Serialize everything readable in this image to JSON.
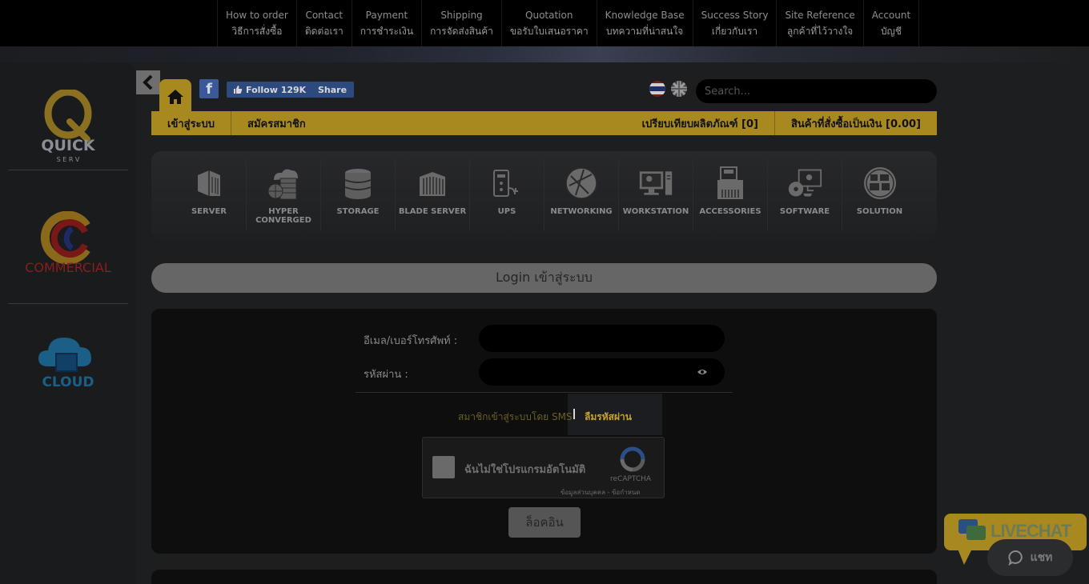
{
  "topnav": [
    {
      "en": "How to order",
      "th": "วิธีการสั่งซื้อ"
    },
    {
      "en": "Contact",
      "th": "ติดต่อเรา"
    },
    {
      "en": "Payment",
      "th": "การชำระเงิน"
    },
    {
      "en": "Shipping",
      "th": "การจัดส่งสินค้า"
    },
    {
      "en": "Quotation",
      "th": "ขอรับใบเสนอราคา"
    },
    {
      "en": "Knowledge Base",
      "th": "บทความที่น่าสนใจ"
    },
    {
      "en": "Success Story",
      "th": "เกี่ยวกับเรา"
    },
    {
      "en": "Site Reference",
      "th": "ลูกค้าที่ไว้วางใจ"
    },
    {
      "en": "Account",
      "th": "บัญชี"
    }
  ],
  "brands": {
    "quick": {
      "main": "QUICK",
      "sub": "S E R V"
    },
    "commercial": "COMMERCIAL",
    "cloud": "CLOUD"
  },
  "social": {
    "facebook_glyph": "f",
    "follow_label": "Follow 129K",
    "share_label": "Share"
  },
  "search": {
    "placeholder": "Search..."
  },
  "ybar": {
    "login": "เข้าสู่ระบบ",
    "register": "สมัครสมาชิก",
    "compare": "เปรียบเทียบผลิตภัณฑ์ [0]",
    "cart": "สินค้าที่สั่งซื้อเป็นเงิน [0.00]"
  },
  "categories": [
    {
      "label": "SERVER",
      "icon": "server-icon"
    },
    {
      "label": "HYPER CONVERGED",
      "icon": "hyper-converged-icon"
    },
    {
      "label": "STORAGE",
      "icon": "storage-icon"
    },
    {
      "label": "BLADE SERVER",
      "icon": "blade-server-icon"
    },
    {
      "label": "UPS",
      "icon": "ups-icon"
    },
    {
      "label": "NETWORKING",
      "icon": "networking-icon"
    },
    {
      "label": "WORKSTATION",
      "icon": "workstation-icon"
    },
    {
      "label": "ACCESSORIES",
      "icon": "accessories-icon"
    },
    {
      "label": "SOFTWARE",
      "icon": "software-icon"
    },
    {
      "label": "SOLUTION",
      "icon": "solution-icon"
    }
  ],
  "login": {
    "title": "Login เข้าสู่ระบบ",
    "email_label": "อีเมล/เบอร์โทรศัพท์ :",
    "email_value": "",
    "password_label": "รหัสผ่าน :",
    "password_value": "",
    "sms_link": "สมาชิกเข้าสู่ระบบโดย SMS",
    "forgot_link": "ลืมรหัสผ่าน",
    "captcha_text": "ฉันไม่ใช่โปรแกรมอัตโนมัติ",
    "captcha_brand": "reCAPTCHA",
    "captcha_links": "ข้อมูลส่วนบุคคล - ข้อกำหนด",
    "submit_label": "ล็อคอิน"
  },
  "livechat": {
    "banner": "LIVECHAT",
    "chat_label": "แชท"
  },
  "colors": {
    "accent": "#a8891f",
    "background": "#1d1e20",
    "panel": "#0e0e0f"
  }
}
